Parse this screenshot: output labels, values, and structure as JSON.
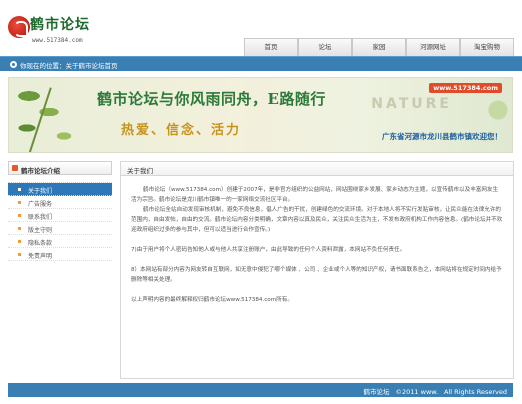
{
  "header": {
    "logo_title": "鹤市论坛",
    "logo_url": "www.517384.com",
    "nav": [
      "首页",
      "论坛",
      "家园",
      "河源网址",
      "淘宝购物"
    ]
  },
  "breadcrumb": {
    "text": "你现在的位置：关于鹤市论坛首页"
  },
  "banner": {
    "title": "鹤市论坛与你风雨同舟，E路随行",
    "subtitle": "热爱、信念、活力",
    "web": "www.517384.com",
    "nature": "NATURE",
    "slogan": "广东省河源市龙川县鹤市镇欢迎您！"
  },
  "sidebar": {
    "title": "鹤市论坛介绍",
    "items": [
      {
        "label": "关于我们",
        "active": true
      },
      {
        "label": "广告服务",
        "active": false
      },
      {
        "label": "联系我们",
        "active": false
      },
      {
        "label": "版主守则",
        "active": false
      },
      {
        "label": "隐私条款",
        "active": false
      },
      {
        "label": "免责声明",
        "active": false
      }
    ]
  },
  "main": {
    "title": "关于我们",
    "paragraphs": [
      "鹤市论坛（www.517384.com）创建于2007年，是非官方组织的公益网站，网站围绕家乡发展、家乡动态为主题，以宣传鹤市以及丰富网友生活为宗旨。鹤市论坛是龙川鹤市镇唯一的一家网络交流社区平台。",
      "鹤市论坛全站自动发现审核机制，避免不良信息，倡人广告的干扰，创建绿色的交流环境。对于本地人将不实行发贴审核，让民众能在法律允许的范围内，自由发帖，自由的交流。鹤市论坛内容分类明确，文章内容以真及民众，关注民众生活为主，不发布政府机构工作内容信息。(鹤市论坛并不欢迎政府组织过多的参与其中，但可以适当进行合作宣传。)",
      "7)由于用户将个人密码告知他人或与他人共享注册账户，由此导致的任何个人资料泄露，本网站不负任何责任。",
      "8）本网站有部分内容为网友转自互联网，如无意中侵犯了哪个媒体 、公司 、企业或个人等的知识产权，请书面联系告之，本网站将在规定时间内给予删除等相关处理。",
      "以上声明内容的最终解释权归鹤市论坛www.517384.com所有。"
    ]
  },
  "footer": {
    "site": "鹤市论坛",
    "copyright": "©2011 www.",
    "rights": "All Rights Reserved"
  },
  "colors": {
    "primary_blue": "#3a7fb4",
    "active_item": "#2f78b7",
    "banner_green": "#2c7a3a",
    "banner_gold": "#c8931a"
  }
}
